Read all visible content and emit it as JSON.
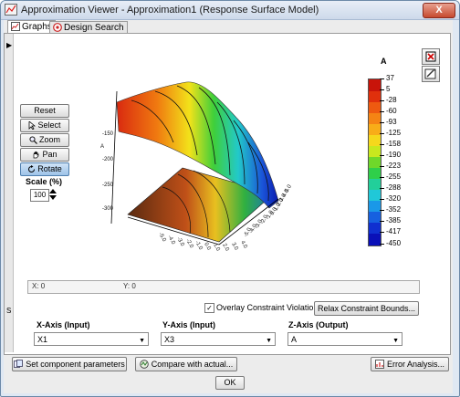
{
  "window": {
    "title": "Approximation Viewer - Approximation1 (Response Surface Model)",
    "close_symbol": "X"
  },
  "tabs": [
    {
      "label": "Graphs"
    },
    {
      "label": "Design Search"
    }
  ],
  "controls": {
    "reset": "Reset",
    "select": "Select",
    "zoom": "Zoom",
    "pan": "Pan",
    "rotate": "Rotate"
  },
  "scale": {
    "label": "Scale (%)",
    "value": "100"
  },
  "legend": {
    "title": "A",
    "ticks": [
      "37",
      "5",
      "-28",
      "-60",
      "-93",
      "-125",
      "-158",
      "-190",
      "-223",
      "-255",
      "-288",
      "-320",
      "-352",
      "-385",
      "-417",
      "-450"
    ]
  },
  "plot": {
    "z_ticks": [
      "-150",
      "-200",
      "-250",
      "-300"
    ],
    "z_letter": "A",
    "x_ticks": [
      "-5.0",
      "-4.0",
      "-3.0",
      "-2.0",
      "-1.0",
      "0.0",
      "1.0",
      "2.0",
      "3.0",
      "4.0"
    ],
    "y_ticks": [
      "-5.0",
      "-4.0",
      "-3.0",
      "-2.0",
      "-1.0",
      "0.0",
      "1.0",
      "2.0",
      "3.0",
      "4.0",
      "5.0"
    ]
  },
  "coords": {
    "x": "X: 0",
    "y": "Y: 0"
  },
  "overlay": {
    "label": "Overlay Constraint Violations",
    "checked": true,
    "check_glyph": "✓"
  },
  "relax_button": "Relax Constraint Bounds...",
  "axes": {
    "x": {
      "label": "X-Axis (Input)",
      "value": "X1"
    },
    "y": {
      "label": "Y-Axis (Input)",
      "value": "X3"
    },
    "z": {
      "label": "Z-Axis (Output)",
      "value": "A"
    }
  },
  "buttons": {
    "set_params": "Set component parameters",
    "compare": "Compare with actual...",
    "error": "Error Analysis...",
    "ok": "OK"
  }
}
